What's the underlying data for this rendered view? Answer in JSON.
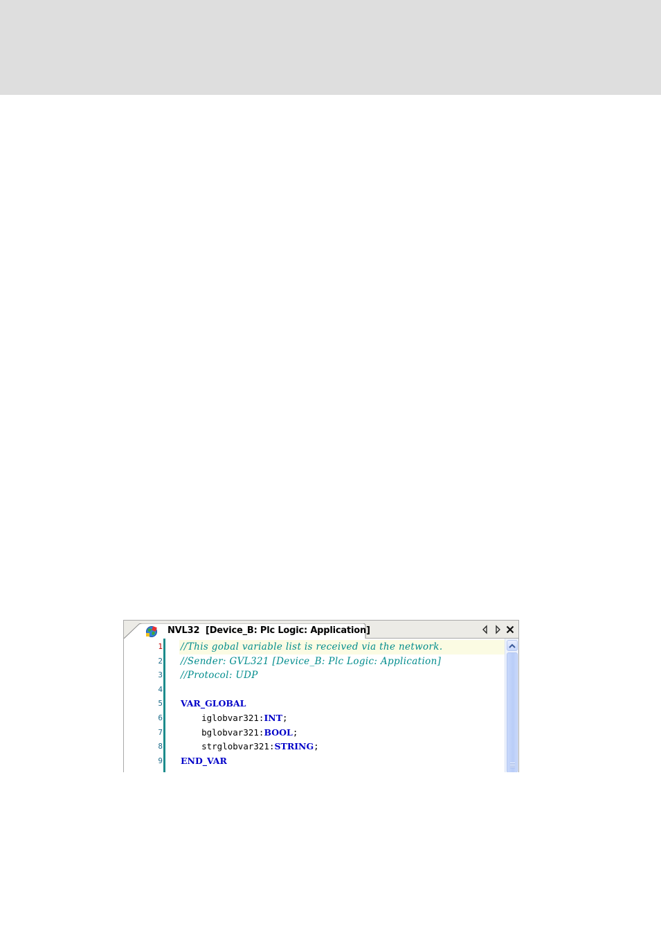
{
  "tab": {
    "title": "NVL32  [Device_B: Plc Logic: Application]",
    "icon": "globe-icon"
  },
  "tab_controls": {
    "previous": "tab-previous-icon",
    "next": "tab-next-icon",
    "close": "close-icon"
  },
  "code": {
    "current_line": 1,
    "lines": [
      {
        "number": "1",
        "text": "//This gobal variable list is received via the network."
      },
      {
        "number": "2",
        "text": "//Sender: GVL321 [Device_B: Plc Logic: Application]"
      },
      {
        "number": "3",
        "text": "//Protocol: UDP"
      },
      {
        "number": "4",
        "text": ""
      },
      {
        "number": "5",
        "text": "VAR_GLOBAL"
      },
      {
        "number": "6",
        "indent": "    ",
        "name": "iglobvar321",
        "sep": ":",
        "type": "INT",
        "end": ";"
      },
      {
        "number": "7",
        "indent": "    ",
        "name": "bglobvar321",
        "sep": ":",
        "type": "BOOL",
        "end": ";"
      },
      {
        "number": "8",
        "indent": "    ",
        "name": "strglobvar321",
        "sep": ":",
        "type": "STRING",
        "end": ";"
      },
      {
        "number": "9",
        "text": "END_VAR"
      }
    ]
  },
  "colors": {
    "comment": "#008c8c",
    "keyword": "#0000c8",
    "line_number": "#1b6b8a",
    "current_line_number": "#c00000",
    "gutter_bar": "#1c8c8c",
    "current_line_background": "#fbfbe3",
    "top_band": "#dedede"
  }
}
